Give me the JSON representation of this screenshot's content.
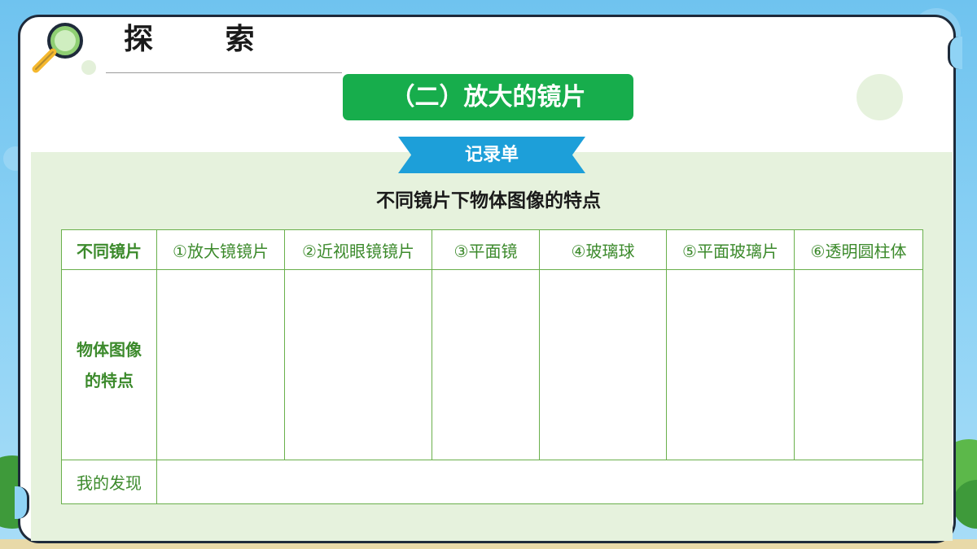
{
  "page": {
    "heading": "探 索",
    "title": "（二）放大的镜片",
    "ribbon": "记录单",
    "table_title": "不同镜片下物体图像的特点"
  },
  "table": {
    "header_label": "不同镜片",
    "columns": [
      "①放大镜镜片",
      "②近视眼镜镜片",
      "③平面镜",
      "④玻璃球",
      "⑤平面玻璃片",
      "⑥透明圆柱体"
    ],
    "row_label_line1": "物体图像",
    "row_label_line2": "的特点",
    "findings_label": "我的发现"
  },
  "colors": {
    "banner_green": "#17ad4c",
    "ribbon_blue": "#1d9fd9",
    "table_border": "#6ab04c",
    "table_text": "#3c8a2c",
    "panel_green": "#e6f2dd"
  },
  "icons": {
    "magnifier": "magnifier-icon"
  }
}
